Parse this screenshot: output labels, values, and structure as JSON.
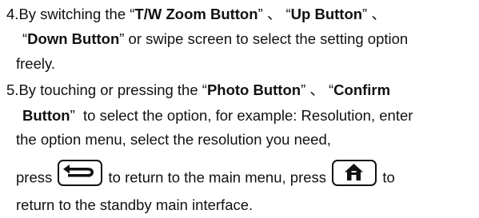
{
  "step4": {
    "line1": {
      "num": "4.",
      "t1": "By switching the “",
      "b1": "T/W Zoom Button",
      "t2": "” 、 “",
      "b2": "Up Button",
      "t3": "” 、"
    },
    "line2": {
      "t1": "“",
      "b1": "Down Button",
      "t2": "” or swipe screen to select the setting option"
    },
    "line3": "freely."
  },
  "step5": {
    "line1": {
      "num": "5.",
      "t1": "By touching or pressing the “",
      "b1": "Photo Button",
      "t2": "” 、 “",
      "b2": "Confirm"
    },
    "line2": {
      "b1": "Button",
      "t1": "”  to select the option, for example: Resolution, enter"
    },
    "line3": "the option menu, select the resolution you need,",
    "line4": {
      "t1": "press",
      "t2": "to return to the main menu, press",
      "t3": "to"
    },
    "line5": "return to the standby main interface."
  },
  "icons": {
    "back": "back-arrow-icon",
    "home": "home-icon"
  }
}
